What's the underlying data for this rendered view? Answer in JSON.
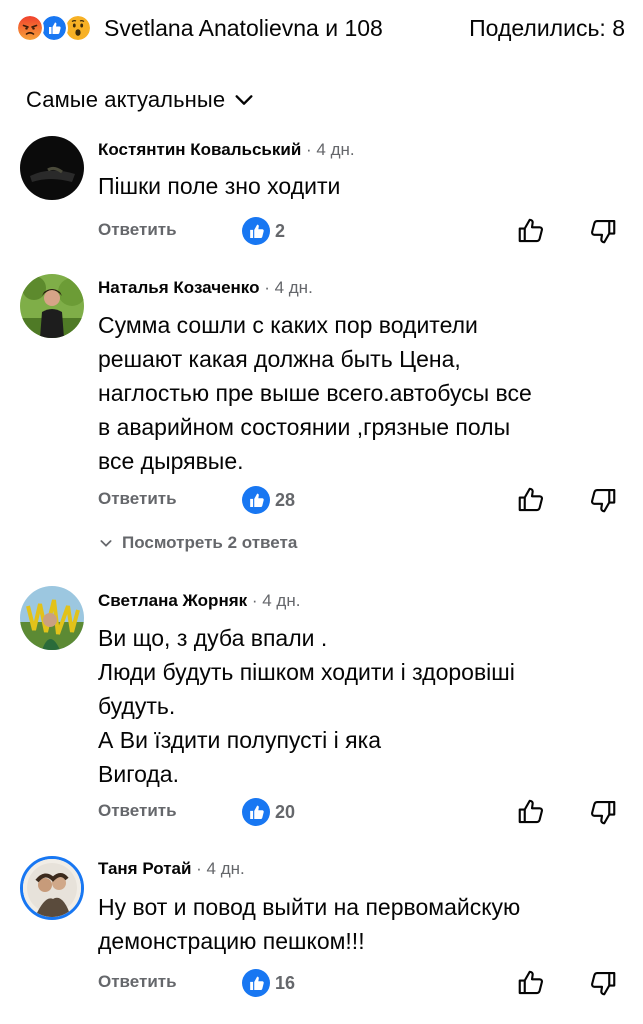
{
  "header": {
    "summary": "Svetlana Anatolievna и 108",
    "shares": "Поделились: 8",
    "reaction_icons": [
      "angry-icon",
      "like-icon",
      "wow-icon"
    ],
    "colors": {
      "like": "#1877f2",
      "angry": "#e9710f",
      "wow": "#f7b125"
    }
  },
  "sort": {
    "label": "Самые актуальные"
  },
  "comments": [
    {
      "author": "Костянтин Ковальський",
      "time": "· 4 дн.",
      "text": "Пішки поле зно ходити",
      "reply_label": "Ответить",
      "likes": "2"
    },
    {
      "author": "Наталья Козаченко",
      "time": "· 4 дн.",
      "text": "Сумма сошли с каких пор водители\nрешают какая должна быть Цена,\nнаглостью пре выше всего.автобусы все\nв аварийном состоянии ,грязные полы\nвсе дырявые.",
      "reply_label": "Ответить",
      "likes": "28",
      "view_replies": "Посмотреть 2 ответа"
    },
    {
      "author": "Светлана Жорняк",
      "time": "· 4 дн.",
      "text": "Ви що, з дуба впали .\nЛюди будуть пішком ходити і здоровіші\nбудуть.\nА Ви їздити  полупусті і яка\nВигода.",
      "reply_label": "Ответить",
      "likes": "20"
    },
    {
      "author": "Таня Ротай",
      "time": "· 4 дн.",
      "text": "Ну вот и повод выйти  на первомайскую\nдемонстрацию пешком!!!",
      "reply_label": "Ответить",
      "likes": "16"
    }
  ]
}
